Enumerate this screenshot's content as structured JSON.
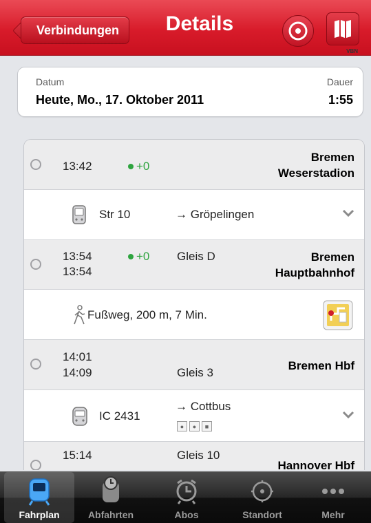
{
  "navbar": {
    "back_label": "Verbindungen",
    "title": "Details",
    "tiny_text": "VBN",
    "icons": [
      "target-icon",
      "map-icon"
    ]
  },
  "date_card": {
    "date_label": "Datum",
    "date_value": "Heute, Mo., 17. Oktober 2011",
    "duration_label": "Dauer",
    "duration_value": "1:55"
  },
  "stops": [
    {
      "time1": "13:42",
      "time2": "",
      "delay": "+0",
      "track": "",
      "station": [
        "Bremen",
        "Weserstadion"
      ]
    },
    {
      "time1": "13:54",
      "time2": "13:54",
      "delay": "+0",
      "track": "Gleis D",
      "station": [
        "Bremen",
        "Hauptbahnhof"
      ]
    },
    {
      "time1": "14:01",
      "time2": "14:09",
      "delay": "",
      "track": "Gleis 3",
      "station": [
        "Bremen Hbf"
      ]
    },
    {
      "time1": "15:14",
      "time2": "",
      "delay": "",
      "track": "Gleis 10",
      "station": [
        "Hannover Hbf"
      ]
    }
  ],
  "legs": [
    {
      "icon": "tram-icon",
      "line": "Str 10",
      "direction": "→ Gröpelingen",
      "expandable": true
    },
    {
      "icon": "walk-icon",
      "line": "Fußweg, 200 m, 7 Min.",
      "direction": "",
      "expandable": false,
      "action_icon": "walk-map-icon"
    },
    {
      "icon": "train-icon",
      "line": "IC 2431",
      "direction": "→ Cottbus",
      "expandable": true,
      "service_icons": [
        "bike-icon",
        "bike-icon",
        "reservation-icon"
      ]
    }
  ],
  "colors": {
    "brand_red": "#d81b2a",
    "delay_green": "#2ea43f"
  },
  "tabbar": {
    "tabs": [
      {
        "label": "Fahrplan",
        "icon": "timetable-icon",
        "active": true
      },
      {
        "label": "Abfahrten",
        "icon": "departures-icon",
        "active": false
      },
      {
        "label": "Abos",
        "icon": "alarm-clock-icon",
        "active": false
      },
      {
        "label": "Standort",
        "icon": "location-icon",
        "active": false
      },
      {
        "label": "Mehr",
        "icon": "more-icon",
        "active": false
      }
    ]
  }
}
